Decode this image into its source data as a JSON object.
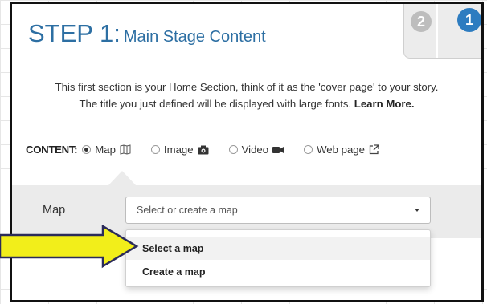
{
  "header": {
    "step_label": "STEP 1:",
    "section_title": "Main Stage Content",
    "step_tabs": [
      "2",
      "1"
    ]
  },
  "description": {
    "line1": "This first section is your Home Section, think of it as the 'cover page' to your story.",
    "line2": "The title you just defined will be displayed with large fonts.",
    "learn_more": "Learn More."
  },
  "content": {
    "label": "CONTENT:",
    "options": [
      {
        "label": "Map",
        "icon": "map-icon",
        "checked": true
      },
      {
        "label": "Image",
        "icon": "camera-icon",
        "checked": false
      },
      {
        "label": "Video",
        "icon": "video-camera-icon",
        "checked": false
      },
      {
        "label": "Web page",
        "icon": "external-link-icon",
        "checked": false
      }
    ]
  },
  "map_field": {
    "label": "Map",
    "placeholder": "Select or create a map"
  },
  "dropdown": {
    "items": [
      "Select a map",
      "Create a map"
    ]
  },
  "colors": {
    "title_blue": "#2d6fa3",
    "step_blue": "#2d7cc0",
    "arrow_yellow": "#f2ee1a",
    "panel_gray": "#ebebeb"
  }
}
